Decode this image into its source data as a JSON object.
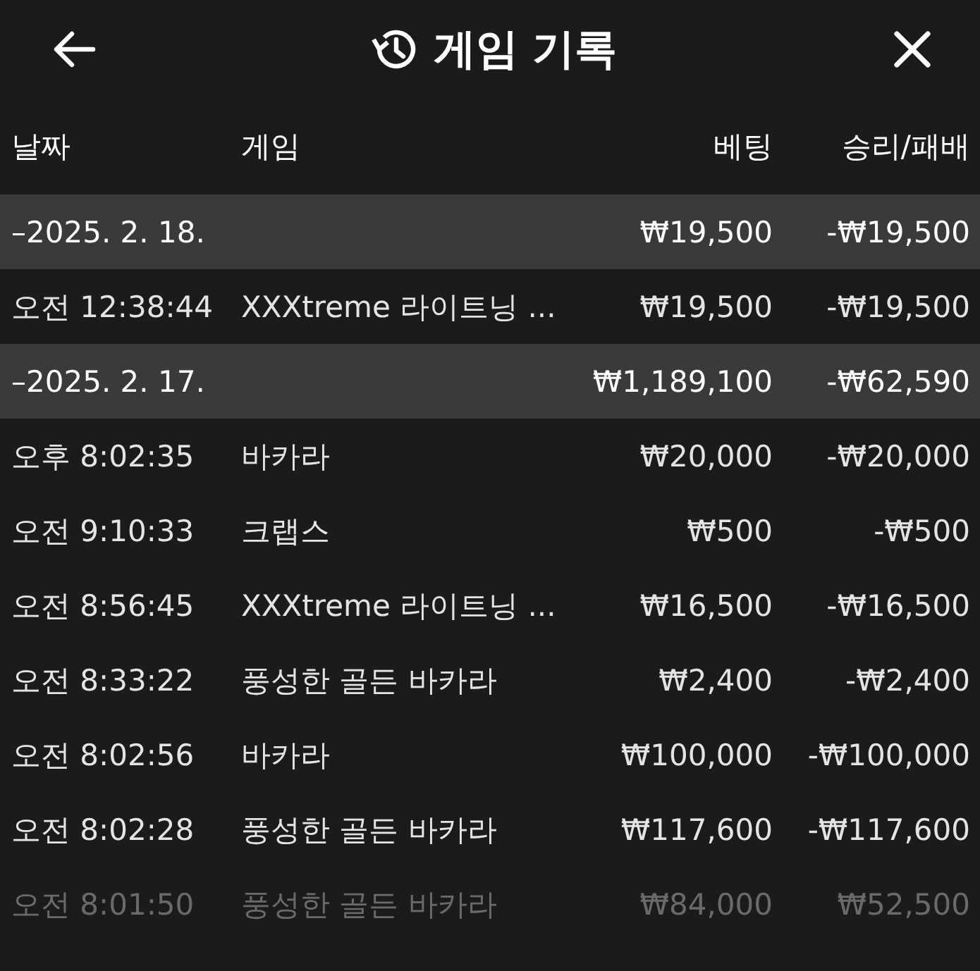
{
  "header": {
    "title": "게임 기록"
  },
  "columns": [
    "날짜",
    "게임",
    "베팅",
    "승리/패배"
  ],
  "rows": [
    {
      "kind": "group",
      "date": "–2025. 2. 18.",
      "bet": "₩19,500",
      "result": "-₩19,500",
      "faded": false
    },
    {
      "kind": "entry",
      "time": "오전 12:38:44",
      "game": "XXXtreme 라이트닝 ...",
      "bet": "₩19,500",
      "result": "-₩19,500",
      "faded": false
    },
    {
      "kind": "group",
      "date": "–2025. 2. 17.",
      "bet": "₩1,189,100",
      "result": "-₩62,590",
      "faded": false
    },
    {
      "kind": "entry",
      "time": "오후 8:02:35",
      "game": "바카라",
      "bet": "₩20,000",
      "result": "-₩20,000",
      "faded": false
    },
    {
      "kind": "entry",
      "time": "오전 9:10:33",
      "game": "크랩스",
      "bet": "₩500",
      "result": "-₩500",
      "faded": false
    },
    {
      "kind": "entry",
      "time": "오전 8:56:45",
      "game": "XXXtreme 라이트닝 ...",
      "bet": "₩16,500",
      "result": "-₩16,500",
      "faded": false
    },
    {
      "kind": "entry",
      "time": "오전 8:33:22",
      "game": "풍성한 골든 바카라",
      "bet": "₩2,400",
      "result": "-₩2,400",
      "faded": false
    },
    {
      "kind": "entry",
      "time": "오전 8:02:56",
      "game": "바카라",
      "bet": "₩100,000",
      "result": "-₩100,000",
      "faded": false
    },
    {
      "kind": "entry",
      "time": "오전 8:02:28",
      "game": "풍성한 골든 바카라",
      "bet": "₩117,600",
      "result": "-₩117,600",
      "faded": false
    },
    {
      "kind": "entry",
      "time": "오전 8:01:50",
      "game": "풍성한 골든 바카라",
      "bet": "₩84,000",
      "result": "₩52,500",
      "faded": true
    }
  ]
}
